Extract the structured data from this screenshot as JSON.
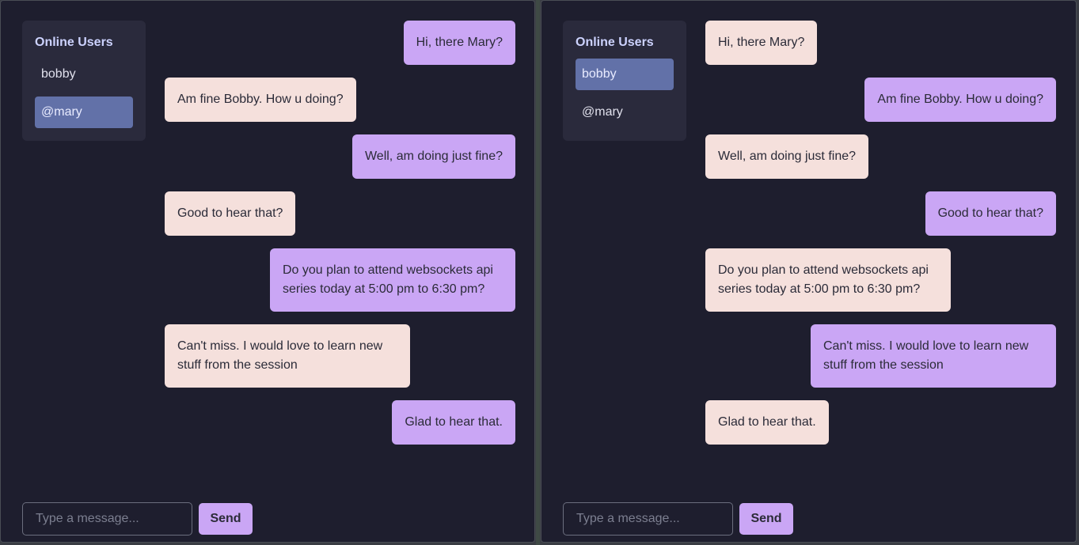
{
  "colors": {
    "background": "#1e1e2e",
    "sidebar": "#2a2a3c",
    "selected_user": "#6271a8",
    "bubble_purple": "#caa6f5",
    "bubble_pink": "#f5e0dc"
  },
  "panels": [
    {
      "sidebar": {
        "title": "Online Users",
        "users": [
          {
            "label": "bobby",
            "selected": false
          },
          {
            "label": "@mary",
            "selected": true
          }
        ]
      },
      "messages": [
        {
          "text": "Hi, there Mary?",
          "side": "out",
          "color": "purple"
        },
        {
          "text": "Am fine Bobby. How u doing?",
          "side": "in",
          "color": "pink"
        },
        {
          "text": "Well, am doing just fine?",
          "side": "out",
          "color": "purple"
        },
        {
          "text": "Good to hear that?",
          "side": "in",
          "color": "pink"
        },
        {
          "text": "Do you plan to attend websockets api series today at 5:00 pm to 6:30 pm?",
          "side": "out",
          "color": "purple"
        },
        {
          "text": "Can't miss. I would love to learn new stuff from the session",
          "side": "in",
          "color": "pink"
        },
        {
          "text": "Glad to hear that.",
          "side": "out",
          "color": "purple"
        }
      ],
      "composer": {
        "placeholder": "Type a message...",
        "send_label": "Send"
      }
    },
    {
      "sidebar": {
        "title": "Online Users",
        "users": [
          {
            "label": "bobby",
            "selected": true
          },
          {
            "label": "@mary",
            "selected": false
          }
        ]
      },
      "messages": [
        {
          "text": "Hi, there Mary?",
          "side": "in",
          "color": "pink"
        },
        {
          "text": "Am fine Bobby. How u doing?",
          "side": "out",
          "color": "purple"
        },
        {
          "text": "Well, am doing just fine?",
          "side": "in",
          "color": "pink"
        },
        {
          "text": "Good to hear that?",
          "side": "out",
          "color": "purple"
        },
        {
          "text": "Do you plan to attend websockets api series today at 5:00 pm to 6:30 pm?",
          "side": "in",
          "color": "pink"
        },
        {
          "text": "Can't miss. I would love to learn new stuff from the session",
          "side": "out",
          "color": "purple"
        },
        {
          "text": "Glad to hear that.",
          "side": "in",
          "color": "pink"
        }
      ],
      "composer": {
        "placeholder": "Type a message...",
        "send_label": "Send"
      }
    }
  ]
}
